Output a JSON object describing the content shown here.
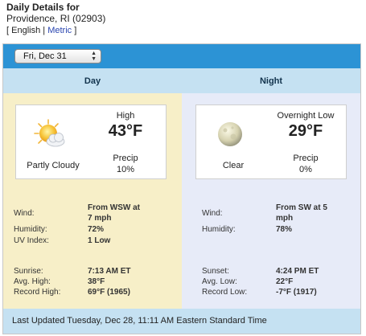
{
  "header": {
    "title": "Daily Details for",
    "location": "Providence, RI (02903)",
    "units_open": "[",
    "units_english": "English",
    "units_sep": "|",
    "units_metric": "Metric",
    "units_close": "]"
  },
  "date_select": {
    "value": "Fri, Dec 31"
  },
  "columns": {
    "day": "Day",
    "night": "Night"
  },
  "day": {
    "condition": "Partly Cloudy",
    "temp_label": "High",
    "temp": "43°F",
    "precip_label": "Precip",
    "precip": "10%",
    "icon": "partly-cloudy-icon",
    "wind_label": "Wind:",
    "wind_line1": "From WSW at",
    "wind_line2": "7 mph",
    "humidity_label": "Humidity:",
    "humidity": "72%",
    "uv_label": "UV Index:",
    "uv": "1 Low",
    "sunrise_label": "Sunrise:",
    "sunrise": "7:13 AM ET",
    "avg_label": "Avg. High:",
    "avg": "38°F",
    "record_label": "Record High:",
    "record": "69°F (1965)"
  },
  "night": {
    "condition": "Clear",
    "temp_label": "Overnight Low",
    "temp": "29°F",
    "precip_label": "Precip",
    "precip": "0%",
    "icon": "full-moon-icon",
    "wind_label": "Wind:",
    "wind_line1": "From SW at 5",
    "wind_line2": "mph",
    "humidity_label": "Humidity:",
    "humidity": "78%",
    "sunset_label": "Sunset:",
    "sunset": "4:24 PM ET",
    "avg_label": "Avg. Low:",
    "avg": "22°F",
    "record_label": "Record Low:",
    "record": "-7°F (1917)"
  },
  "footer": {
    "updated": "Last Updated Tuesday, Dec 28, 11:11 AM Eastern Standard Time"
  },
  "colors": {
    "topbar": "#2c93d5",
    "column_header": "#c5e1f2",
    "day_bg": "#f7efc8",
    "night_bg": "#e7ebf8",
    "link": "#2a45b0"
  }
}
